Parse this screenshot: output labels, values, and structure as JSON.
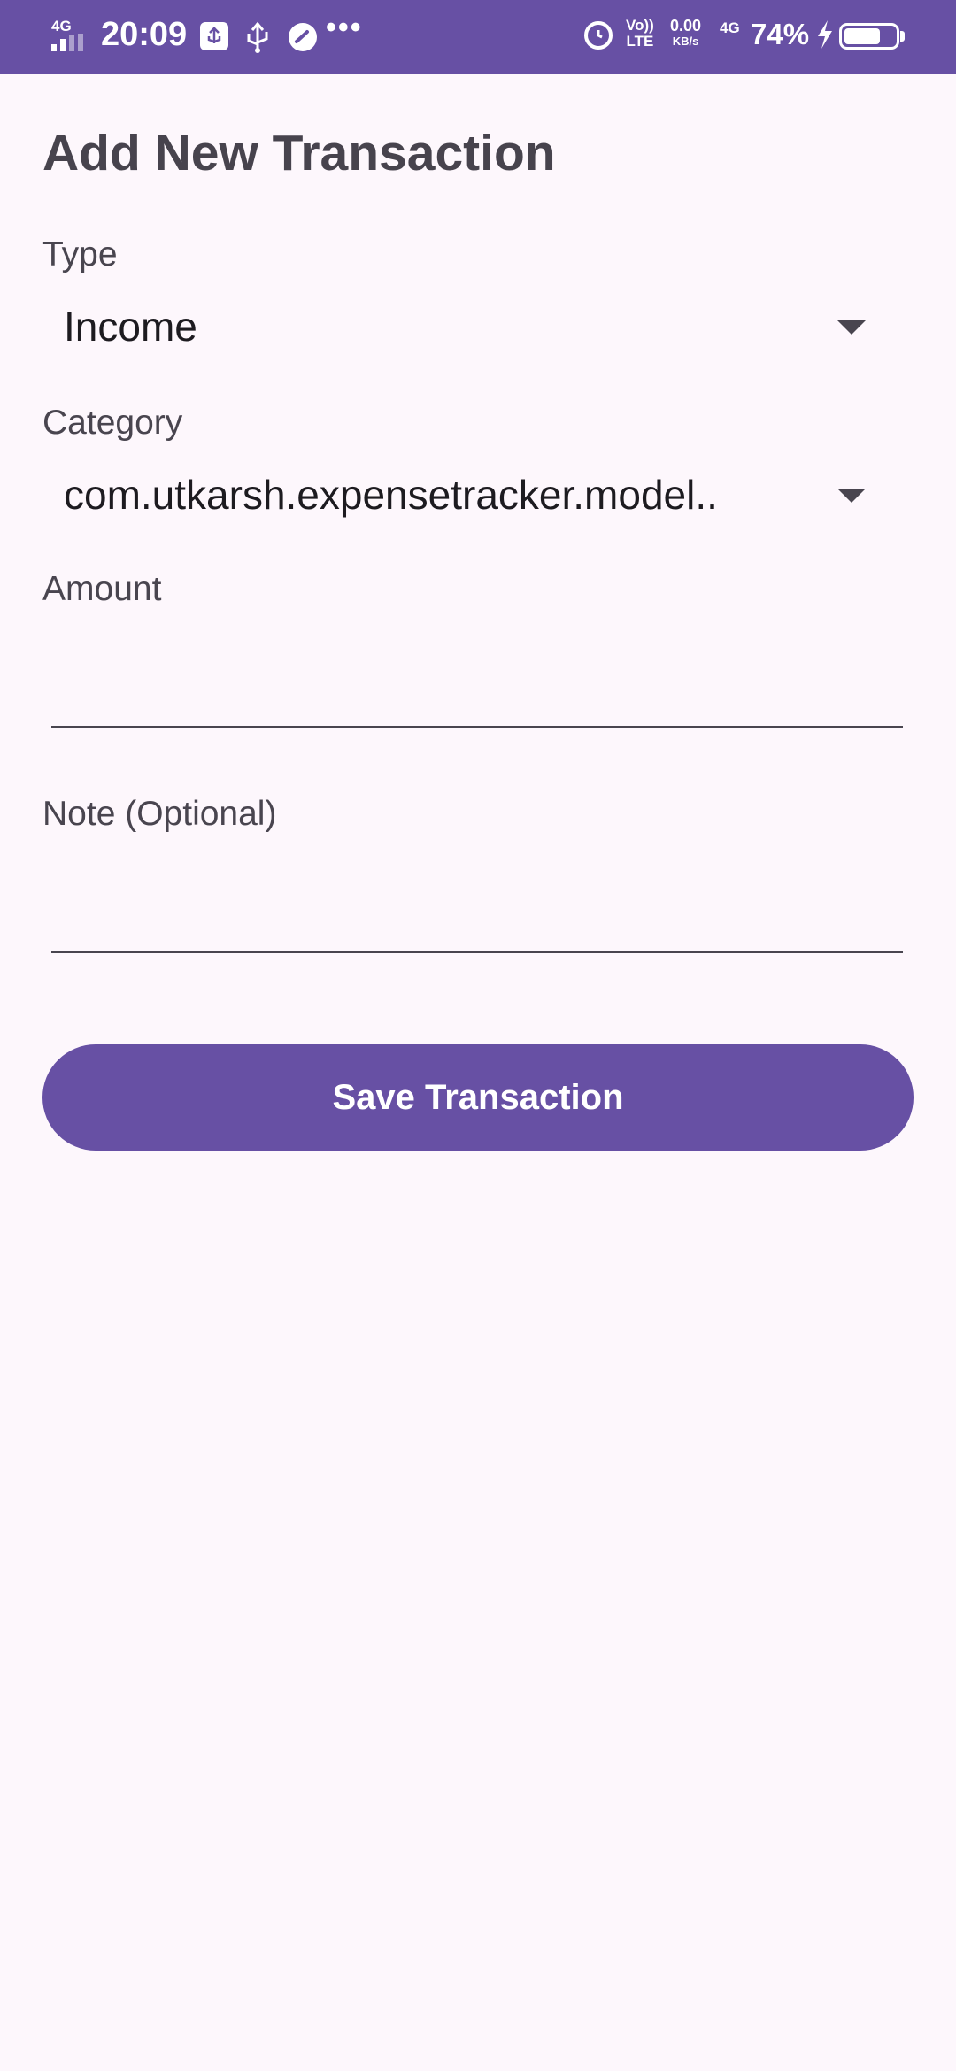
{
  "status_bar": {
    "network_label": "4G",
    "time": "20:09",
    "more_indicator": "•••",
    "volte_top": "Vo))",
    "volte_bottom": "LTE",
    "speed_value": "0.00",
    "speed_unit": "KB/s",
    "network_type": "4G",
    "battery_percent": "74%",
    "battery_level": 0.74,
    "icons": [
      "signal-icon",
      "usb-settings-icon",
      "usb-icon",
      "speed-meter-icon",
      "alarm-icon",
      "charging-icon",
      "battery-icon"
    ]
  },
  "screen": {
    "title": "Add New Transaction"
  },
  "form": {
    "type_label": "Type",
    "type_value": "Income",
    "category_label": "Category",
    "category_value": "com.utkarsh.expensetracker.model..",
    "amount_label": "Amount",
    "amount_value": "",
    "note_label": "Note (Optional)",
    "note_value": "",
    "save_label": "Save Transaction"
  },
  "colors": {
    "primary": "#6750a4",
    "background": "#fdf7fc",
    "text": "#49454f"
  }
}
